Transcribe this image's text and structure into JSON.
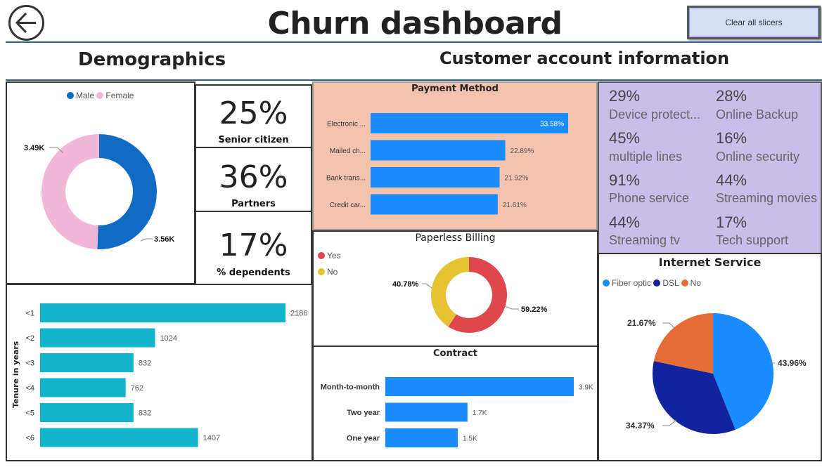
{
  "header": {
    "title": "Churn dashboard",
    "clear_slicers_label": "Clear all slicers",
    "back_icon": "arrow-left-icon"
  },
  "sections": {
    "demographics": "Demographics",
    "account_info": "Customer account information"
  },
  "gender": {
    "legend": [
      "Male",
      "Female"
    ],
    "male_label": "3.56K",
    "female_label": "3.49K",
    "colors": {
      "male": "#0f6bc4",
      "female": "#f2b6d9"
    }
  },
  "kpis": [
    {
      "value": "25%",
      "label": "Senior citizen"
    },
    {
      "value": "36%",
      "label": "Partners"
    },
    {
      "value": "17%",
      "label": "% dependents"
    }
  ],
  "tenure": {
    "axis_label": "Tenure in years",
    "color": "#12b4cb"
  },
  "payment": {
    "title": "Payment Method",
    "bg": "#f4c3ae",
    "color": "#1a8cff"
  },
  "paperless": {
    "title": "Paperless Billing",
    "legend": [
      "Yes",
      "No"
    ],
    "colors": {
      "yes": "#e0474c",
      "no": "#e6c331"
    }
  },
  "contract": {
    "title": "Contract",
    "color": "#1a8cff"
  },
  "services": {
    "bg": "#c9bde9",
    "items": [
      {
        "pct": "29%",
        "label": "Device protect..."
      },
      {
        "pct": "28%",
        "label": "Online Backup"
      },
      {
        "pct": "45%",
        "label": "multiple lines"
      },
      {
        "pct": "16%",
        "label": "Online security"
      },
      {
        "pct": "91%",
        "label": "Phone service"
      },
      {
        "pct": "44%",
        "label": "Streaming movies"
      },
      {
        "pct": "44%",
        "label": "Streaming tv"
      },
      {
        "pct": "17%",
        "label": "Tech support"
      }
    ]
  },
  "internet": {
    "title": "Internet Service",
    "legend": [
      "Fiber optic",
      "DSL",
      "No"
    ],
    "colors": {
      "fiber": "#1a8cff",
      "dsl": "#12239e",
      "no": "#e66c37"
    }
  },
  "chart_data": [
    {
      "type": "pie",
      "categories": [
        "Male",
        "Female"
      ],
      "values": [
        3.56,
        3.49
      ],
      "data_labels": [
        "3.56K",
        "3.49K"
      ]
    },
    {
      "type": "bar",
      "orientation": "horizontal",
      "categories": [
        "<1",
        "<2",
        "<3",
        "<4",
        "<5",
        "<6"
      ],
      "values": [
        2186,
        1024,
        832,
        762,
        832,
        1407
      ],
      "data_labels": [
        "2186",
        "1024",
        "832",
        "762",
        "832",
        "1407"
      ],
      "ylabel": "Tenure in years"
    },
    {
      "type": "bar",
      "orientation": "horizontal",
      "title": "Payment Method",
      "categories": [
        "Electronic ...",
        "Mailed ch...",
        "Bank trans...",
        "Credit car..."
      ],
      "values": [
        33.58,
        22.89,
        21.92,
        21.61
      ],
      "data_labels": [
        "33.58%",
        "22.89%",
        "21.92%",
        "21.61%"
      ]
    },
    {
      "type": "pie",
      "title": "Paperless Billing",
      "categories": [
        "Yes",
        "No"
      ],
      "values": [
        59.22,
        40.78
      ],
      "data_labels": [
        "59.22%",
        "40.78%"
      ]
    },
    {
      "type": "bar",
      "orientation": "horizontal",
      "title": "Contract",
      "categories": [
        "Month-to-month",
        "Two year",
        "One year"
      ],
      "values": [
        3.9,
        1.7,
        1.5
      ],
      "data_labels": [
        "3.9K",
        "1.7K",
        "1.5K"
      ]
    },
    {
      "type": "pie",
      "title": "Internet Service",
      "categories": [
        "Fiber optic",
        "DSL",
        "No"
      ],
      "values": [
        43.96,
        34.37,
        21.67
      ],
      "data_labels": [
        "43.96%",
        "34.37%",
        "21.67%"
      ]
    }
  ]
}
